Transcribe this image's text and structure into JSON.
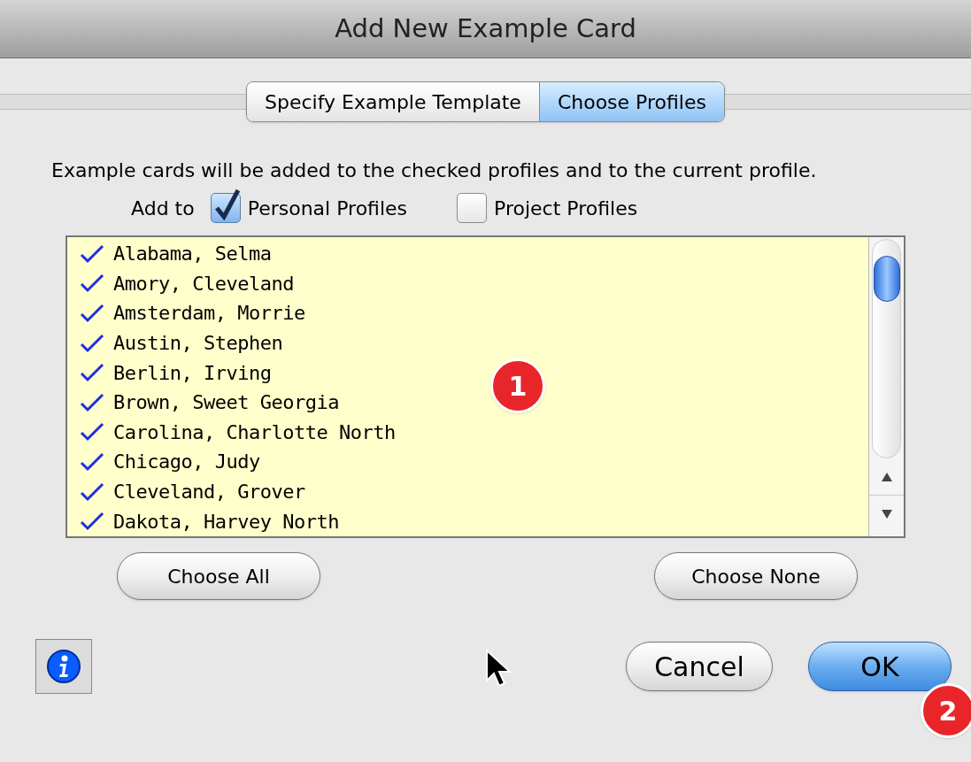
{
  "window": {
    "title": "Add New Example Card"
  },
  "tabs": [
    {
      "label": "Specify Example Template",
      "selected": false
    },
    {
      "label": "Choose Profiles",
      "selected": true
    }
  ],
  "description": "Example cards will be added to the checked profiles and to the current profile.",
  "add_to": {
    "label": "Add to",
    "options": [
      {
        "label": "Personal Profiles",
        "checked": true
      },
      {
        "label": "Project Profiles",
        "checked": false
      }
    ]
  },
  "profiles": [
    {
      "name": "Alabama, Selma",
      "checked": true
    },
    {
      "name": "Amory, Cleveland",
      "checked": true
    },
    {
      "name": "Amsterdam, Morrie",
      "checked": true
    },
    {
      "name": "Austin, Stephen",
      "checked": true
    },
    {
      "name": "Berlin, Irving",
      "checked": true
    },
    {
      "name": "Brown, Sweet Georgia",
      "checked": true
    },
    {
      "name": "Carolina, Charlotte North",
      "checked": true
    },
    {
      "name": "Chicago, Judy",
      "checked": true
    },
    {
      "name": "Cleveland, Grover",
      "checked": true
    },
    {
      "name": "Dakota, Harvey North",
      "checked": true
    }
  ],
  "list_buttons": [
    "Choose All",
    "Choose None"
  ],
  "dialog_buttons": [
    {
      "label": "Cancel",
      "default": false
    },
    {
      "label": "OK",
      "default": true
    }
  ],
  "callouts": [
    "1",
    "2"
  ]
}
